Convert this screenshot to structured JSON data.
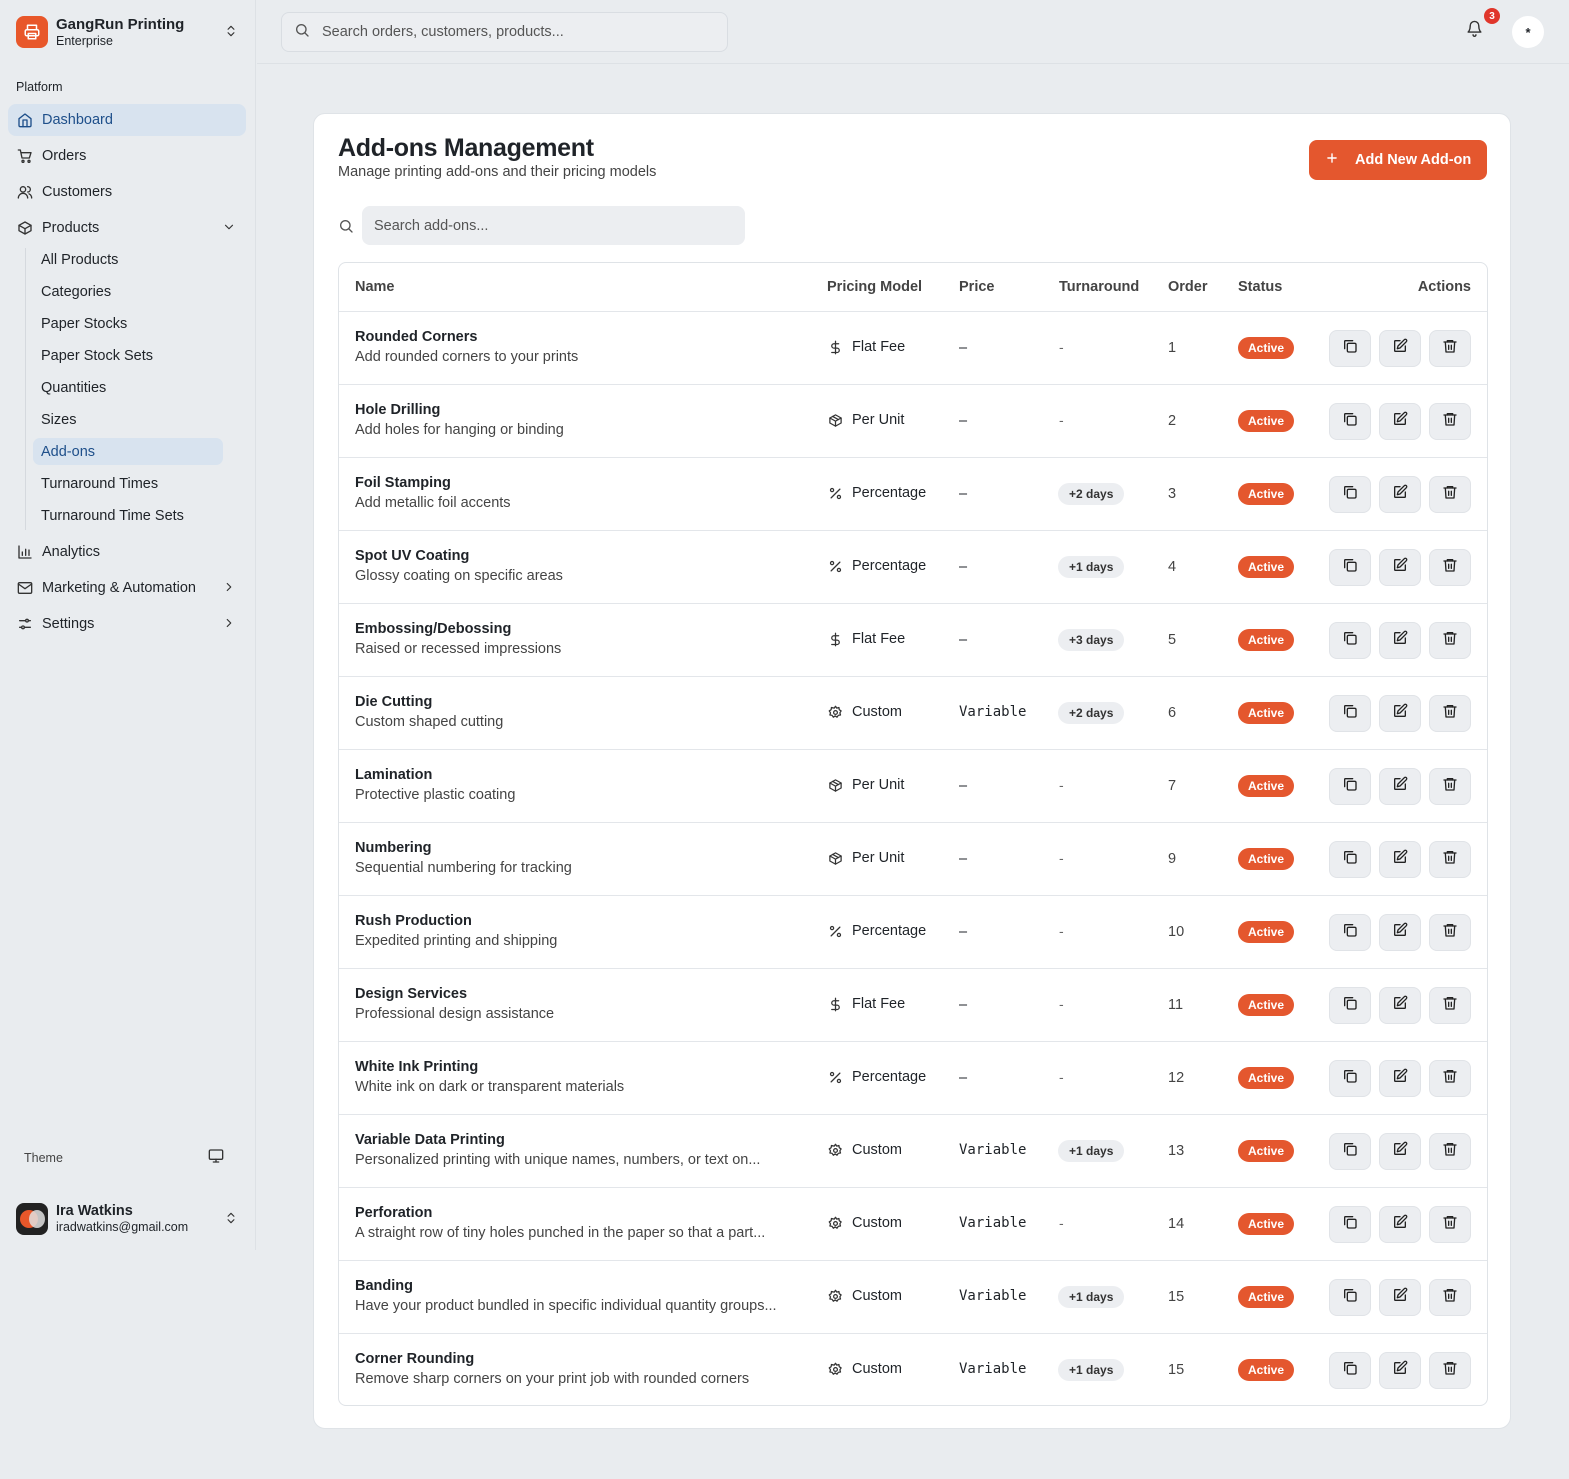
{
  "brand": {
    "name": "GangRun Printing",
    "plan": "Enterprise",
    "accent": "#e4572e"
  },
  "sidebar": {
    "section_label": "Platform",
    "items": [
      {
        "label": "Dashboard",
        "icon": "home-icon"
      },
      {
        "label": "Orders",
        "icon": "cart-icon"
      },
      {
        "label": "Customers",
        "icon": "users-icon"
      },
      {
        "label": "Products",
        "icon": "package-icon"
      },
      {
        "label": "Analytics",
        "icon": "bar-chart-icon"
      },
      {
        "label": "Marketing & Automation",
        "icon": "mail-icon"
      },
      {
        "label": "Settings",
        "icon": "sliders-icon"
      }
    ],
    "product_subitems": [
      "All Products",
      "Categories",
      "Paper Stocks",
      "Paper Stock Sets",
      "Quantities",
      "Sizes",
      "Add-ons",
      "Turnaround Times",
      "Turnaround Time Sets"
    ],
    "active_item": "Dashboard",
    "active_subitem": "Add-ons",
    "theme_label": "Theme",
    "user": {
      "name": "Ira Watkins",
      "email": "iradwatkins@gmail.com"
    }
  },
  "topbar": {
    "search_placeholder": "Search orders, customers, products...",
    "notification_count": "3",
    "avatar_initial": "*"
  },
  "page": {
    "title": "Add-ons Management",
    "subtitle": "Manage printing add-ons and their pricing models",
    "add_button": "Add New Add-on",
    "search_placeholder": "Search add-ons..."
  },
  "table": {
    "columns": [
      "Name",
      "Pricing Model",
      "Price",
      "Turnaround",
      "Order",
      "Status",
      "Actions"
    ],
    "rows": [
      {
        "name": "Rounded Corners",
        "description": "Add rounded corners to your prints",
        "pricing_model": "Flat Fee",
        "pricing_icon": "dollar-icon",
        "price": "–",
        "turnaround": "-",
        "order": "1",
        "status": "Active"
      },
      {
        "name": "Hole Drilling",
        "description": "Add holes for hanging or binding",
        "pricing_model": "Per Unit",
        "pricing_icon": "package-icon",
        "price": "–",
        "turnaround": "-",
        "order": "2",
        "status": "Active"
      },
      {
        "name": "Foil Stamping",
        "description": "Add metallic foil accents",
        "pricing_model": "Percentage",
        "pricing_icon": "percent-icon",
        "price": "–",
        "turnaround": "+2 days",
        "order": "3",
        "status": "Active"
      },
      {
        "name": "Spot UV Coating",
        "description": "Glossy coating on specific areas",
        "pricing_model": "Percentage",
        "pricing_icon": "percent-icon",
        "price": "–",
        "turnaround": "+1 days",
        "order": "4",
        "status": "Active"
      },
      {
        "name": "Embossing/Debossing",
        "description": "Raised or recessed impressions",
        "pricing_model": "Flat Fee",
        "pricing_icon": "dollar-icon",
        "price": "–",
        "turnaround": "+3 days",
        "order": "5",
        "status": "Active"
      },
      {
        "name": "Die Cutting",
        "description": "Custom shaped cutting",
        "pricing_model": "Custom",
        "pricing_icon": "gear-icon",
        "price": "Variable",
        "turnaround": "+2 days",
        "order": "6",
        "status": "Active"
      },
      {
        "name": "Lamination",
        "description": "Protective plastic coating",
        "pricing_model": "Per Unit",
        "pricing_icon": "package-icon",
        "price": "–",
        "turnaround": "-",
        "order": "7",
        "status": "Active"
      },
      {
        "name": "Numbering",
        "description": "Sequential numbering for tracking",
        "pricing_model": "Per Unit",
        "pricing_icon": "package-icon",
        "price": "–",
        "turnaround": "-",
        "order": "9",
        "status": "Active"
      },
      {
        "name": "Rush Production",
        "description": "Expedited printing and shipping",
        "pricing_model": "Percentage",
        "pricing_icon": "percent-icon",
        "price": "–",
        "turnaround": "-",
        "order": "10",
        "status": "Active"
      },
      {
        "name": "Design Services",
        "description": "Professional design assistance",
        "pricing_model": "Flat Fee",
        "pricing_icon": "dollar-icon",
        "price": "–",
        "turnaround": "-",
        "order": "11",
        "status": "Active"
      },
      {
        "name": "White Ink Printing",
        "description": "White ink on dark or transparent materials",
        "pricing_model": "Percentage",
        "pricing_icon": "percent-icon",
        "price": "–",
        "turnaround": "-",
        "order": "12",
        "status": "Active"
      },
      {
        "name": "Variable Data Printing",
        "description": "Personalized printing with unique names, numbers, or text on...",
        "pricing_model": "Custom",
        "pricing_icon": "gear-icon",
        "price": "Variable",
        "turnaround": "+1 days",
        "order": "13",
        "status": "Active"
      },
      {
        "name": "Perforation",
        "description": "A straight row of tiny holes punched in the paper so that a part...",
        "pricing_model": "Custom",
        "pricing_icon": "gear-icon",
        "price": "Variable",
        "turnaround": "-",
        "order": "14",
        "status": "Active"
      },
      {
        "name": "Banding",
        "description": "Have your product bundled in specific individual quantity groups...",
        "pricing_model": "Custom",
        "pricing_icon": "gear-icon",
        "price": "Variable",
        "turnaround": "+1 days",
        "order": "15",
        "status": "Active"
      },
      {
        "name": "Corner Rounding",
        "description": "Remove sharp corners on your print job with rounded corners",
        "pricing_model": "Custom",
        "pricing_icon": "gear-icon",
        "price": "Variable",
        "turnaround": "+1 days",
        "order": "15",
        "status": "Active"
      }
    ]
  }
}
